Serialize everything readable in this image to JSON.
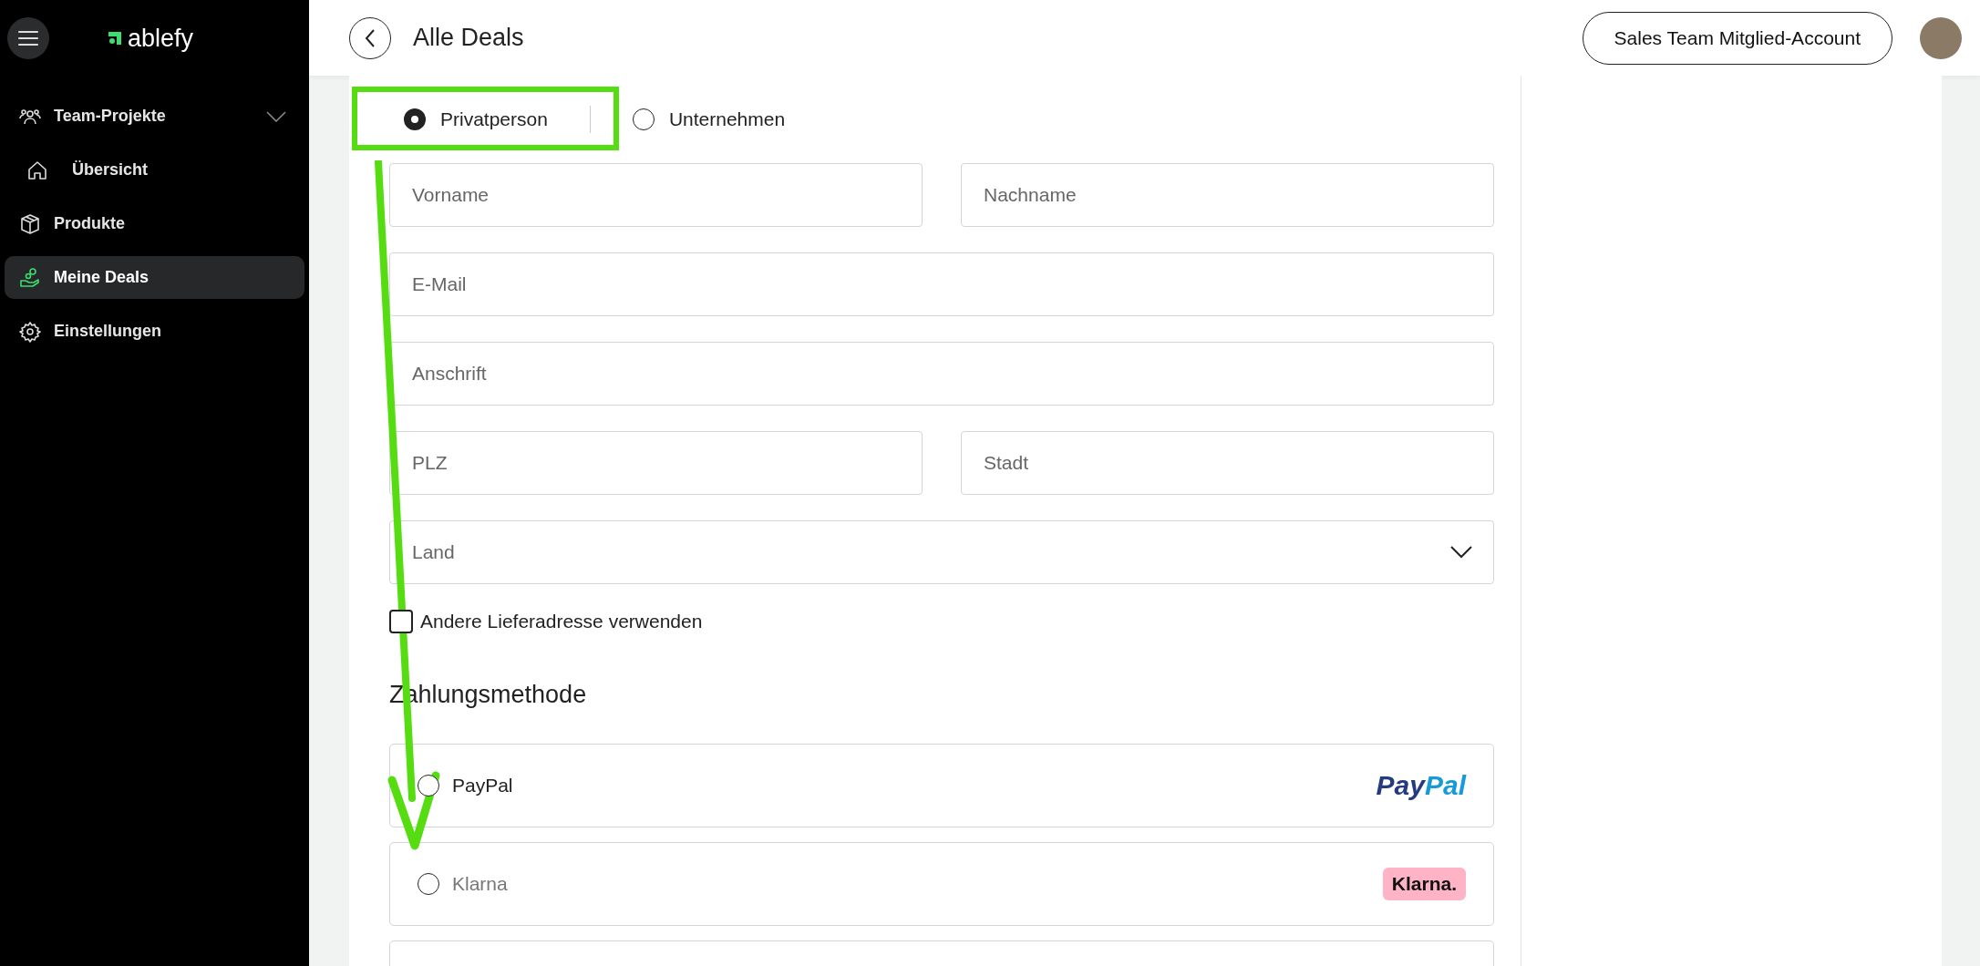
{
  "sidebar": {
    "logo": "ablefy",
    "items": [
      {
        "label": "Team-Projekte",
        "selected": false,
        "expandable": true
      },
      {
        "label": "Übersicht",
        "selected": false,
        "expandable": false
      },
      {
        "label": "Produkte",
        "selected": false,
        "expandable": false
      },
      {
        "label": "Meine Deals",
        "selected": true,
        "expandable": false
      },
      {
        "label": "Einstellungen",
        "selected": false,
        "expandable": false
      }
    ]
  },
  "header": {
    "title": "Alle Deals",
    "account_button": "Sales Team Mitglied-Account"
  },
  "form": {
    "customer_types": [
      {
        "label": "Privatperson",
        "selected": true
      },
      {
        "label": "Unternehmen",
        "selected": false
      }
    ],
    "field_rows": [
      [
        {
          "placeholder": "Vorname",
          "kind": "text"
        },
        {
          "placeholder": "Nachname",
          "kind": "text"
        }
      ],
      [
        {
          "placeholder": "E-Mail",
          "kind": "text"
        }
      ],
      [
        {
          "placeholder": "Anschrift",
          "kind": "text"
        }
      ],
      [
        {
          "placeholder": "PLZ",
          "kind": "text"
        },
        {
          "placeholder": "Stadt",
          "kind": "text"
        }
      ],
      [
        {
          "placeholder": "Land",
          "kind": "select"
        }
      ]
    ],
    "alt_address": {
      "label": "Andere Lieferadresse verwenden",
      "checked": false
    },
    "payment_heading": "Zahlungsmethode",
    "payment_methods": [
      {
        "label": "PayPal",
        "selected": false,
        "disabled": false,
        "logo_text": [
          "Pay",
          "Pal"
        ]
      },
      {
        "label": "Klarna",
        "selected": false,
        "disabled": true,
        "logo_text": [
          "Klarna."
        ]
      }
    ]
  }
}
